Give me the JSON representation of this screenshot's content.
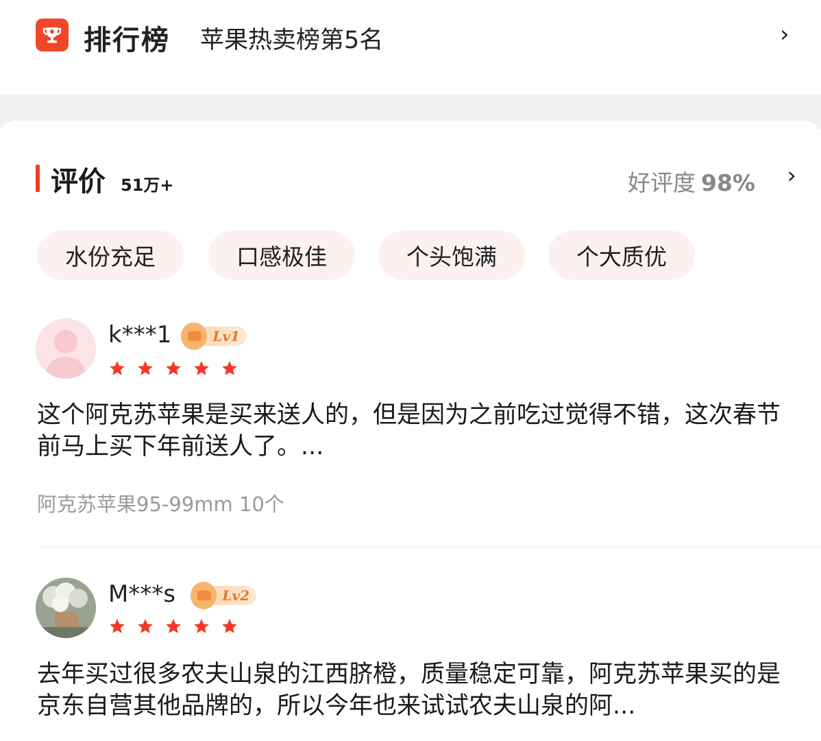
{
  "ranking": {
    "logo_text": "排行榜",
    "text": "苹果热卖榜第5名",
    "chevron": "›"
  },
  "reviews_section": {
    "title": "评价",
    "count": "51万+",
    "rating_label": "好评度",
    "rating_value": "98%",
    "chevron": "›",
    "tags": [
      "水份充足",
      "口感极佳",
      "个头饱满",
      "个大质优"
    ]
  },
  "reviews": [
    {
      "username": "k***1",
      "level": "Lv1",
      "stars": 5,
      "text": "这个阿克苏苹果是买来送人的，但是因为之前吃过觉得不错，这次春节前马上买下年前送人了。...",
      "spec": "阿克苏苹果95-99mm 10个"
    },
    {
      "username": "M***s",
      "level": "Lv2",
      "stars": 5,
      "text": "去年买过很多农夫山泉的江西脐橙，质量稳定可靠，阿克苏苹果买的是京东自营其他品牌的，所以今年也来试试农夫山泉的阿..."
    }
  ],
  "colors": {
    "accent": "#f23a24",
    "rank_icon_bg": "#f0462a",
    "tag_bg": "#fdf0f0",
    "muted_text": "#9a9a9a"
  },
  "icons": {
    "rank": "trophy-icon",
    "star": "star-icon",
    "level": "level-hat-icon"
  }
}
